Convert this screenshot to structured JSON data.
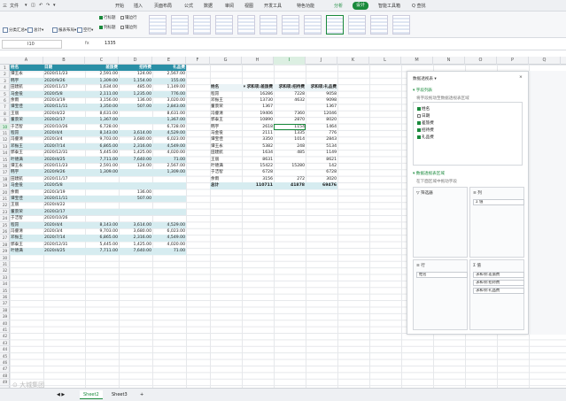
{
  "menu": {
    "left": [
      "三",
      "文件",
      "▾",
      "◫",
      "↶",
      "↷",
      "▾",
      "开始",
      "插入",
      "页面布局",
      "公式",
      "数据",
      "审阅",
      "视图",
      "开发工具",
      "特色功能",
      "分析"
    ],
    "design": "设计",
    "right": [
      "智能工具箱",
      "Q 查找"
    ]
  },
  "ribbon": {
    "labels": [
      "分类汇总▾",
      "总计▾",
      "报表布局▾",
      "空行▾"
    ],
    "checks": [
      {
        "label": "行标题",
        "on": true
      },
      {
        "label": "镶边行",
        "on": false
      },
      {
        "label": "列标题",
        "on": true
      },
      {
        "label": "镶边列",
        "on": false
      }
    ]
  },
  "formula": {
    "namebox": "I10",
    "fx": "fx",
    "value": "1335"
  },
  "columns": [
    "A",
    "B",
    "C",
    "D",
    "E",
    "F",
    "G",
    "H",
    "I",
    "J",
    "K",
    "L",
    "M",
    "N",
    "O",
    "P",
    "Q"
  ],
  "rows": [
    "1",
    "2",
    "3",
    "4",
    "5",
    "6",
    "7",
    "8",
    "9",
    "10",
    "11",
    "12",
    "13",
    "14",
    "15",
    "16",
    "17",
    "18",
    "19",
    "20",
    "21",
    "22",
    "23",
    "24",
    "25",
    "26",
    "27",
    "28",
    "29",
    "30",
    "31",
    "32",
    "33",
    "34",
    "35",
    "36",
    "37",
    "38",
    "39",
    "40",
    "41",
    "42",
    "43",
    "44",
    "45",
    "46",
    "47",
    "48",
    "49"
  ],
  "source": {
    "headers": [
      "姓名",
      "日期",
      "差旅费",
      "招待费",
      "礼品费"
    ],
    "rows": [
      [
        "谭王永",
        "2020/11/23",
        "2,591.00",
        "124.00",
        "2,567.00"
      ],
      [
        "韩宇",
        "2020/9/26",
        "1,309.00",
        "1,154.00",
        "155.00"
      ],
      [
        "田建航",
        "2020/11/17",
        "1,634.00",
        "485.00",
        "1,149.00"
      ],
      [
        "马金役",
        "2020/5/8",
        "2,111.00",
        "1,235.00",
        "776.00"
      ],
      [
        "余雨",
        "2020/3/19",
        "3,156.00",
        "136.00",
        "3,020.00"
      ],
      [
        "谭宝佳",
        "2020/11/11",
        "3,350.00",
        "507.00",
        "2,843.00"
      ],
      [
        "王丽",
        "2020/4/22",
        "8,631.00",
        "",
        "8,631.00"
      ],
      [
        "董景荣",
        "2020/2/17",
        "1,367.00",
        "",
        "1,367.00"
      ],
      [
        "于洁智",
        "2020/10/26",
        "6,728.00",
        "",
        "6,728.00"
      ],
      [
        "程昂",
        "2020/4/4",
        "8,143.00",
        "3,614.00",
        "4,529.00"
      ],
      [
        "冯睿清",
        "2020/3/4",
        "9,703.00",
        "3,680.00",
        "6,023.00"
      ],
      [
        "邓振王",
        "2020/7/14",
        "6,865.00",
        "2,316.00",
        "4,549.00"
      ],
      [
        "郭泰王",
        "2020/12/31",
        "5,445.00",
        "1,425.00",
        "4,020.00"
      ],
      [
        "叶德满",
        "2020/4/25",
        "7,711.00",
        "7,640.00",
        "71.00"
      ],
      [
        "谭王永",
        "2020/11/23",
        "2,591.00",
        "124.00",
        "2,567.00"
      ],
      [
        "韩宇",
        "2020/9/26",
        "1,309.00",
        "",
        "1,309.00"
      ],
      [
        "田建航",
        "2020/11/17",
        "",
        "",
        ""
      ],
      [
        "马金役",
        "2020/5/8",
        "",
        "",
        ""
      ],
      [
        "余雨",
        "2020/3/19",
        "",
        "136.00",
        ""
      ],
      [
        "谭宝佳",
        "2020/11/11",
        "",
        "507.00",
        ""
      ],
      [
        "王丽",
        "2020/4/22",
        "",
        "",
        ""
      ],
      [
        "董景荣",
        "2020/2/17",
        "",
        "",
        ""
      ],
      [
        "于洁智",
        "2020/10/26",
        "",
        "",
        ""
      ],
      [
        "程昂",
        "2020/4/4",
        "8,143.00",
        "3,614.00",
        "4,529.00"
      ],
      [
        "冯睿清",
        "2020/3/4",
        "9,703.00",
        "3,680.00",
        "6,023.00"
      ],
      [
        "邓振王",
        "2020/7/14",
        "6,865.00",
        "2,316.00",
        "4,549.00"
      ],
      [
        "郭泰王",
        "2020/12/31",
        "5,445.00",
        "1,425.00",
        "4,020.00"
      ],
      [
        "叶德满",
        "2020/4/25",
        "7,711.00",
        "7,640.00",
        "71.00"
      ]
    ]
  },
  "pivot": {
    "headers": [
      "姓名",
      "▾ 求和项:差旅费",
      "求和项:招待费",
      "求和项:礼品费"
    ],
    "rows": [
      [
        "程昂",
        "16286",
        "7228",
        "9058"
      ],
      [
        "邓振王",
        "13730",
        "4632",
        "9098"
      ],
      [
        "董景荣",
        "1367",
        "",
        "1367"
      ],
      [
        "冯睿清",
        "19406",
        "7360",
        "12046"
      ],
      [
        "郭泰王",
        "10890",
        "2870",
        "8020"
      ],
      [
        "韩宇",
        "2618",
        "1154",
        "1464"
      ],
      [
        "马金役",
        "2111",
        "1335",
        "776"
      ],
      [
        "谭宝佳",
        "3350",
        "1014",
        "2843"
      ],
      [
        "谭王永",
        "5382",
        "248",
        "5134"
      ],
      [
        "田建航",
        "1634",
        "485",
        "1149"
      ],
      [
        "王丽",
        "8631",
        "",
        "8621"
      ],
      [
        "叶德满",
        "15422",
        "15280",
        "142"
      ],
      [
        "于洁智",
        "6728",
        "",
        "6728"
      ],
      [
        "余雨",
        "3156",
        "272",
        "3020"
      ]
    ],
    "total": [
      "总计",
      "110711",
      "41878",
      "69476"
    ]
  },
  "panel": {
    "title": "数据透视表 ▾",
    "fields_title": "▾ 字段列表",
    "fields_hint": "将字段拖动至数据透视表区域",
    "fields": [
      {
        "label": "姓名",
        "on": true
      },
      {
        "label": "日期",
        "on": false
      },
      {
        "label": "差旅费",
        "on": true
      },
      {
        "label": "招待费",
        "on": true
      },
      {
        "label": "礼品费",
        "on": true
      }
    ],
    "areas_title": "▾ 数据透视表区域",
    "areas_hint": "在下面区域中拖动字段",
    "filter_label": "▽ 筛选器",
    "columns_label": "≡ 列",
    "columns_item": "Σ 值",
    "rows_label": "≡ 行",
    "rows_item": "姓名",
    "values_label": "Σ 值",
    "values_items": [
      "求和项:差旅费",
      "求和项:招待费",
      "求和项:礼品费"
    ]
  },
  "sheets": {
    "tabs": [
      "Sheet2",
      "Sheet3"
    ],
    "active": "Sheet2",
    "add": "+"
  },
  "watermark": "⊙ 大城集团"
}
